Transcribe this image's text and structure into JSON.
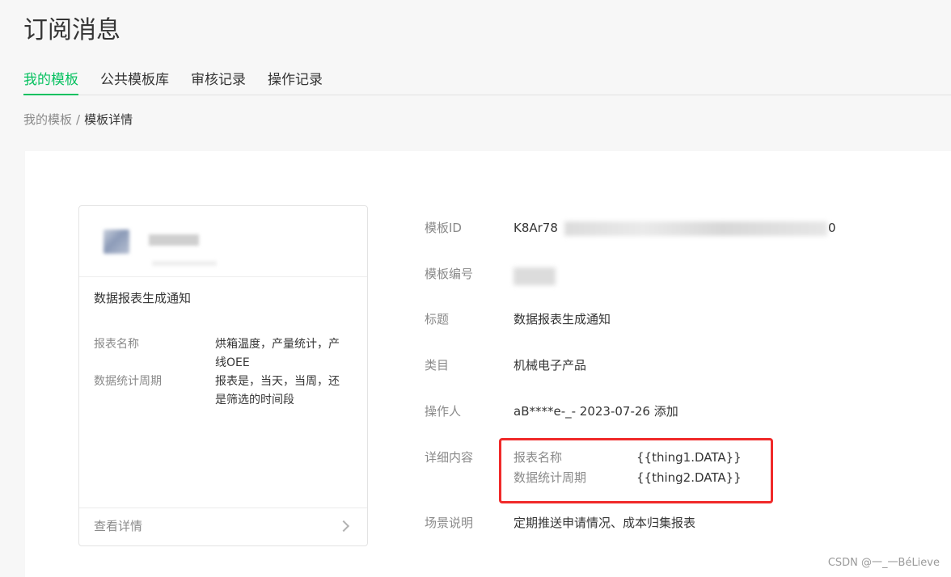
{
  "header": {
    "title": "订阅消息"
  },
  "tabs": [
    {
      "label": "我的模板",
      "active": true
    },
    {
      "label": "公共模板库",
      "active": false
    },
    {
      "label": "审核记录",
      "active": false
    },
    {
      "label": "操作记录",
      "active": false
    }
  ],
  "breadcrumb": {
    "parent": "我的模板",
    "separator": "/",
    "current": "模板详情"
  },
  "preview_card": {
    "title": "数据报表生成通知",
    "fields": [
      {
        "label": "报表名称",
        "value": "烘箱温度，产量统计，产线OEE"
      },
      {
        "label": "数据统计周期",
        "value": "报表是，当天，当周，还是筛选的时间段"
      }
    ],
    "footer_label": "查看详情"
  },
  "details": {
    "template_id": {
      "label": "模板ID",
      "value_prefix": "K8Ar78",
      "value_suffix": "0"
    },
    "template_number": {
      "label": "模板编号"
    },
    "title": {
      "label": "标题",
      "value": "数据报表生成通知"
    },
    "category": {
      "label": "类目",
      "value": "机械电子产品"
    },
    "operator": {
      "label": "操作人",
      "value": "aB****e-_- 2023-07-26 添加"
    },
    "content": {
      "label": "详细内容",
      "lines": [
        {
          "key": "报表名称",
          "value": "{{thing1.DATA}}"
        },
        {
          "key": "数据统计周期",
          "value": "{{thing2.DATA}}"
        }
      ]
    },
    "scene": {
      "label": "场景说明",
      "value": "定期推送申请情况、成本归集报表"
    }
  },
  "watermark": "CSDN @一_一BéLieve",
  "colors": {
    "accent": "#07c160",
    "highlight_border": "#f02a2a"
  }
}
